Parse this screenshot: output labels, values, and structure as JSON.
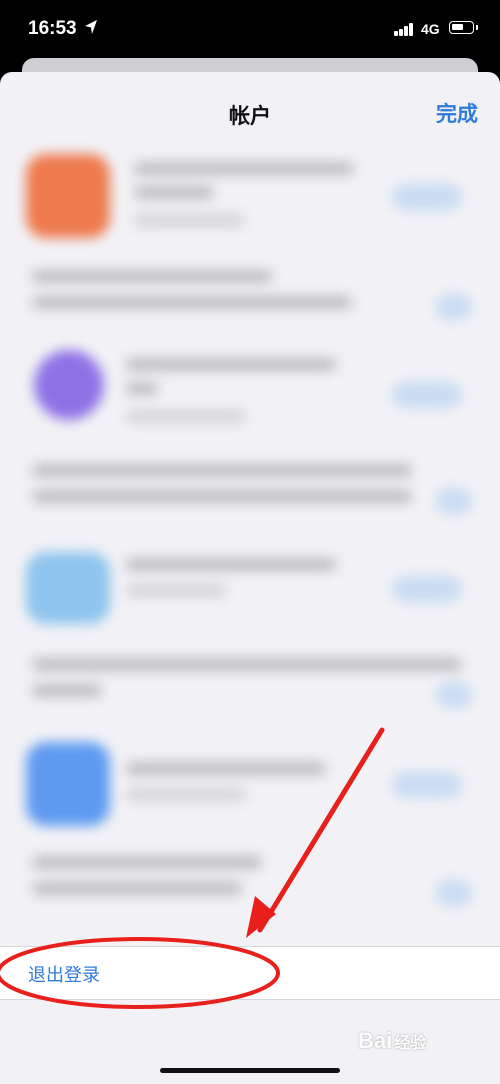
{
  "status_bar": {
    "time": "16:53",
    "network": "4G",
    "icons": [
      "location-arrow-icon",
      "signal-icon",
      "battery-icon"
    ]
  },
  "sheet": {
    "title": "帐户",
    "done_label": "完成"
  },
  "logout": {
    "label": "退出登录"
  },
  "watermark": {
    "text": "Bai",
    "suffix": "经验"
  },
  "colors": {
    "accent": "#2f7bd9",
    "annotation": "#e8201c",
    "app_icons": [
      "#ee7a4e",
      "#8d72e6",
      "#8ec4ee",
      "#5e9af0"
    ]
  }
}
